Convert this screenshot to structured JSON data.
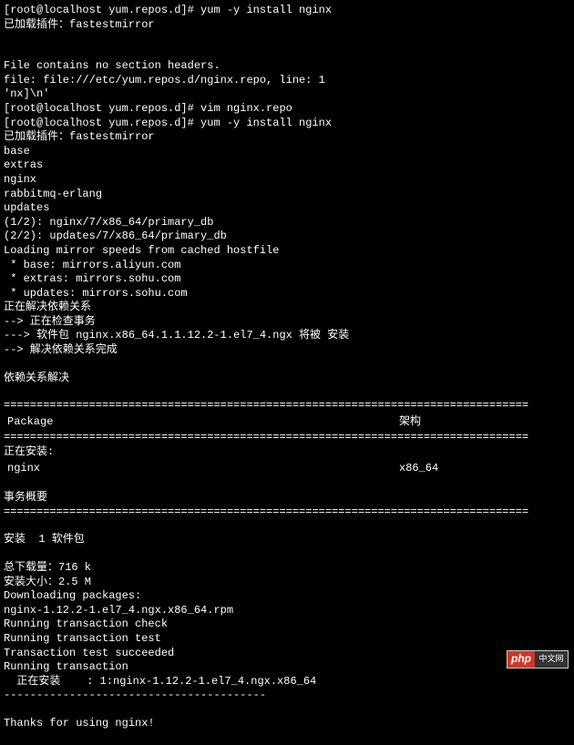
{
  "lines": [
    "[root@localhost yum.repos.d]# yum -y install nginx",
    "已加载插件：fastestmirror",
    "",
    "",
    "File contains no section headers.",
    "file: file:///etc/yum.repos.d/nginx.repo, line: 1",
    "'nx]\\n'",
    "[root@localhost yum.repos.d]# vim nginx.repo",
    "[root@localhost yum.repos.d]# yum -y install nginx",
    "已加载插件：fastestmirror",
    "base",
    "extras",
    "nginx",
    "rabbitmq-erlang",
    "updates",
    "(1/2): nginx/7/x86_64/primary_db",
    "(2/2): updates/7/x86_64/primary_db",
    "Loading mirror speeds from cached hostfile",
    " * base: mirrors.aliyun.com",
    " * extras: mirrors.sohu.com",
    " * updates: mirrors.sohu.com",
    "正在解决依赖关系",
    "--> 正在检查事务",
    "---> 软件包 nginx.x86_64.1.1.12.2-1.el7_4.ngx 将被 安装",
    "--> 解决依赖关系完成",
    "",
    "依赖关系解决",
    ""
  ],
  "table": {
    "header_col1": " Package",
    "header_col2": "架构",
    "installing_label": "正在安装:",
    "row_col1": " nginx",
    "row_col2": "x86_64"
  },
  "summary_lines": [
    "",
    "事务概要"
  ],
  "install_lines": [
    "",
    "安装  1 软件包",
    "",
    "总下载量：716 k",
    "安装大小：2.5 M",
    "Downloading packages:",
    "nginx-1.12.2-1.el7_4.ngx.x86_64.rpm",
    "Running transaction check",
    "Running transaction test",
    "Transaction test succeeded",
    "Running transaction",
    "  正在安装    : 1:nginx-1.12.2-1.el7_4.ngx.x86_64",
    "----------------------------------------",
    "",
    "Thanks for using nginx!",
    ""
  ],
  "divider_double": "================================================================================",
  "divider_single": "================================================================================",
  "logo": {
    "php": "php",
    "cn": "中文网"
  }
}
